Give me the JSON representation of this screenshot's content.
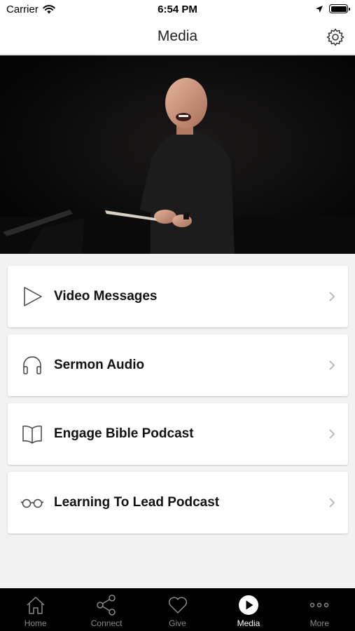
{
  "status_bar": {
    "carrier": "Carrier",
    "time": "6:54 PM"
  },
  "header": {
    "title": "Media"
  },
  "menu": [
    {
      "label": "Video Messages",
      "icon": "play-outline-icon"
    },
    {
      "label": "Sermon Audio",
      "icon": "headphones-icon"
    },
    {
      "label": "Engage Bible Podcast",
      "icon": "open-book-icon"
    },
    {
      "label": "Learning To Lead Podcast",
      "icon": "glasses-icon"
    }
  ],
  "tabs": [
    {
      "label": "Home",
      "icon": "home-icon",
      "active": false
    },
    {
      "label": "Connect",
      "icon": "share-icon",
      "active": false
    },
    {
      "label": "Give",
      "icon": "heart-icon",
      "active": false
    },
    {
      "label": "Media",
      "icon": "play-circle-icon",
      "active": true
    },
    {
      "label": "More",
      "icon": "more-dots-icon",
      "active": false
    }
  ],
  "colors": {
    "tab_bar": "#000000",
    "tab_inactive": "#8a8a8a",
    "tab_active": "#ffffff",
    "background": "#f2f2f2"
  }
}
